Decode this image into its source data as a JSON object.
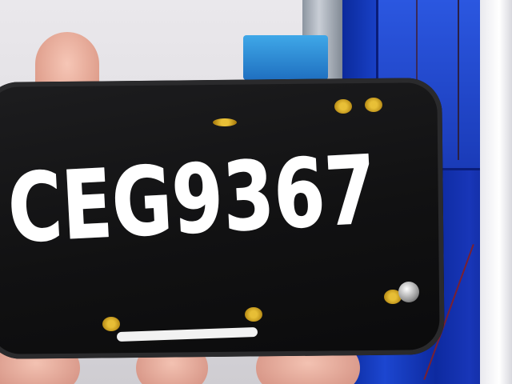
{
  "photo": {
    "handwritten_code": "CEG9367",
    "small_print_text": "",
    "colors": {
      "card": "#141415",
      "writing": "#ffffff",
      "cabinet": "#1836b8",
      "marker_dots": "#ffd23a"
    }
  }
}
